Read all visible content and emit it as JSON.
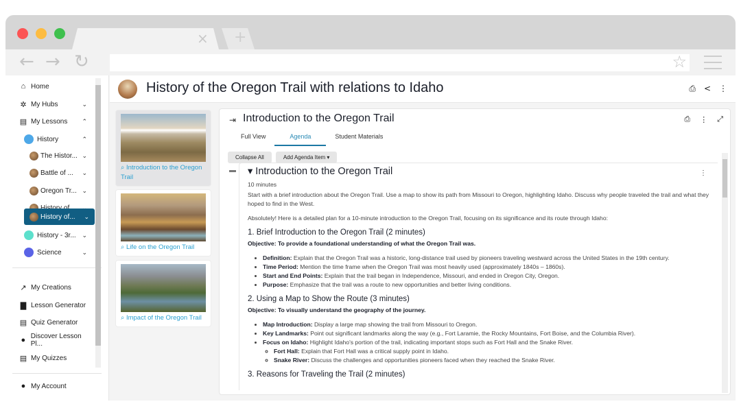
{
  "browser": {
    "tab_close_icon": "×",
    "new_tab_icon": "+",
    "nav": {
      "back_icon": "←",
      "forward_icon": "→",
      "reload_icon": "↻"
    },
    "url": "",
    "bookmark_icon": "☆"
  },
  "sidebar": {
    "items": [
      {
        "label": "Home",
        "icon": "home-icon"
      },
      {
        "label": "My Hubs",
        "icon": "hubs-icon",
        "chevron": "⌄"
      },
      {
        "label": "My Lessons",
        "icon": "book-icon",
        "chevron": "⌃"
      },
      {
        "label": "History",
        "color": "#4ea8e8",
        "chevron": "⌃"
      },
      {
        "label": "The Histor...",
        "chevron": "⌄"
      },
      {
        "label": "Battle of ...",
        "chevron": "⌄"
      },
      {
        "label": "Oregon Tr...",
        "chevron": "⌄"
      },
      {
        "label": "History of...",
        "chevron": "⌄"
      },
      {
        "label": "History of...",
        "chevron": "⌄",
        "active": true
      },
      {
        "label": "History - 3r...",
        "color": "#5de0cc",
        "chevron": "⌄"
      },
      {
        "label": "Science",
        "color": "#5a63e6",
        "chevron": "⌄"
      }
    ],
    "tools": [
      {
        "label": "My Creations",
        "icon": "hammer-icon"
      },
      {
        "label": "Lesson Generator",
        "icon": "document-icon"
      },
      {
        "label": "Quiz Generator",
        "icon": "clipboard-icon"
      },
      {
        "label": "Discover Lesson Pl...",
        "icon": "compass-icon"
      },
      {
        "label": "My Quizzes",
        "icon": "clipboard-icon"
      }
    ],
    "account": {
      "label": "My Account",
      "icon": "person-icon"
    }
  },
  "header": {
    "title": "History of the Oregon Trail with relations to Idaho",
    "icons": [
      "print-icon",
      "share-icon",
      "more-icon"
    ]
  },
  "lesson_cards": [
    {
      "label": "Introduction to the Oregon Trail",
      "selected": true
    },
    {
      "label": "Life on the Oregon Trail",
      "selected": false
    },
    {
      "label": "Impact of the Oregon Trail",
      "selected": false
    }
  ],
  "panel": {
    "title": "Introduction to the Oregon Trail",
    "tabs": [
      "Full View",
      "Agenda",
      "Student Materials"
    ],
    "active_tab": "Agenda",
    "buttons": {
      "collapse_all": "Collapse All",
      "add_agenda_item": "Add Agenda Item ▾"
    },
    "agenda_item": {
      "title": "▾ Introduction to the Oregon Trail",
      "duration": "10 minutes",
      "description": "Start with a brief introduction about the Oregon Trail. Use a map to show its path from Missouri to Oregon, highlighting Idaho. Discuss why people traveled the trail and what they hoped to find in the West.",
      "intro": "Absolutely! Here is a detailed plan for a 10-minute introduction to the Oregon Trail, focusing on its significance and its route through Idaho:",
      "sections": [
        {
          "heading": "1. Brief Introduction to the Oregon Trail (2 minutes)",
          "objective": "Objective: To provide a foundational understanding of what the Oregon Trail was.",
          "bullets": [
            {
              "term": "Definition:",
              "text": " Explain that the Oregon Trail was a historic, long-distance trail used by pioneers traveling westward across the United States in the 19th century."
            },
            {
              "term": "Time Period:",
              "text": " Mention the time frame when the Oregon Trail was most heavily used (approximately 1840s – 1860s)."
            },
            {
              "term": "Start and End Points:",
              "text": " Explain that the trail began in Independence, Missouri, and ended in Oregon City, Oregon."
            },
            {
              "term": "Purpose:",
              "text": " Emphasize that the trail was a route to new opportunities and better living conditions."
            }
          ]
        },
        {
          "heading": "2. Using a Map to Show the Route (3 minutes)",
          "objective": "Objective: To visually understand the geography of the journey.",
          "bullets": [
            {
              "term": "Map Introduction:",
              "text": " Display a large map showing the trail from Missouri to Oregon."
            },
            {
              "term": "Key Landmarks:",
              "text": " Point out significant landmarks along the way (e.g., Fort Laramie, the Rocky Mountains, Fort Boise, and the Columbia River)."
            },
            {
              "term": "Focus on Idaho:",
              "text": " Highlight Idaho's portion of the trail, indicating important stops such as Fort Hall and the Snake River."
            }
          ],
          "sub_bullets": [
            {
              "term": "Fort Hall:",
              "text": " Explain that Fort Hall was a critical supply point in Idaho."
            },
            {
              "term": "Snake River:",
              "text": " Discuss the challenges and opportunities pioneers faced when they reached the Snake River."
            }
          ]
        },
        {
          "heading": "3. Reasons for Traveling the Trail (2 minutes)"
        }
      ]
    }
  }
}
